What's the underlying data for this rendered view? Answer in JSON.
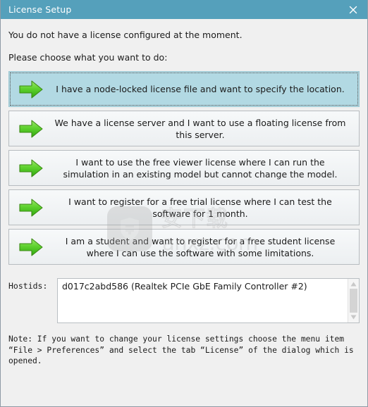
{
  "window": {
    "title": "License Setup",
    "close_icon": "close-icon",
    "titlebar_color": "#55a0bb",
    "body_color": "#f0f0f0"
  },
  "intro": {
    "line1": "You do not have a license configured at the moment.",
    "line2": "Please choose what you want to do:"
  },
  "options": [
    {
      "label": "I have a node-locked license file and want to specify the location.",
      "icon": "green-arrow-icon",
      "selected": true
    },
    {
      "label": "We have a license server and I want to use a floating license from this server.",
      "icon": "green-arrow-icon",
      "selected": false
    },
    {
      "label": "I want to use the free viewer license where I can run the simulation in an existing model but cannot change the model.",
      "icon": "green-arrow-icon",
      "selected": false
    },
    {
      "label": "I want to register for a free trial license where I can test the software for 1 month.",
      "icon": "green-arrow-icon",
      "selected": false
    },
    {
      "label": "I am a student and want to register for a free student license where I can use the software with some limitations.",
      "icon": "green-arrow-icon",
      "selected": false
    }
  ],
  "hostids": {
    "label": "Hostids:",
    "value": "d017c2abd586 (Realtek PCIe GbE Family Controller #2)",
    "scroll_up_icon": "triangle-up-icon",
    "scroll_down_icon": "triangle-down-icon"
  },
  "note": {
    "text": "Note: If you want to change your license settings choose the menu item\n “File > Preferences”  and select the tab “License”  of the dialog which is\nopened."
  },
  "watermark": {
    "chinese": "安下载",
    "domain": "anxz.com",
    "logo_icon": "shield-logo-icon"
  }
}
